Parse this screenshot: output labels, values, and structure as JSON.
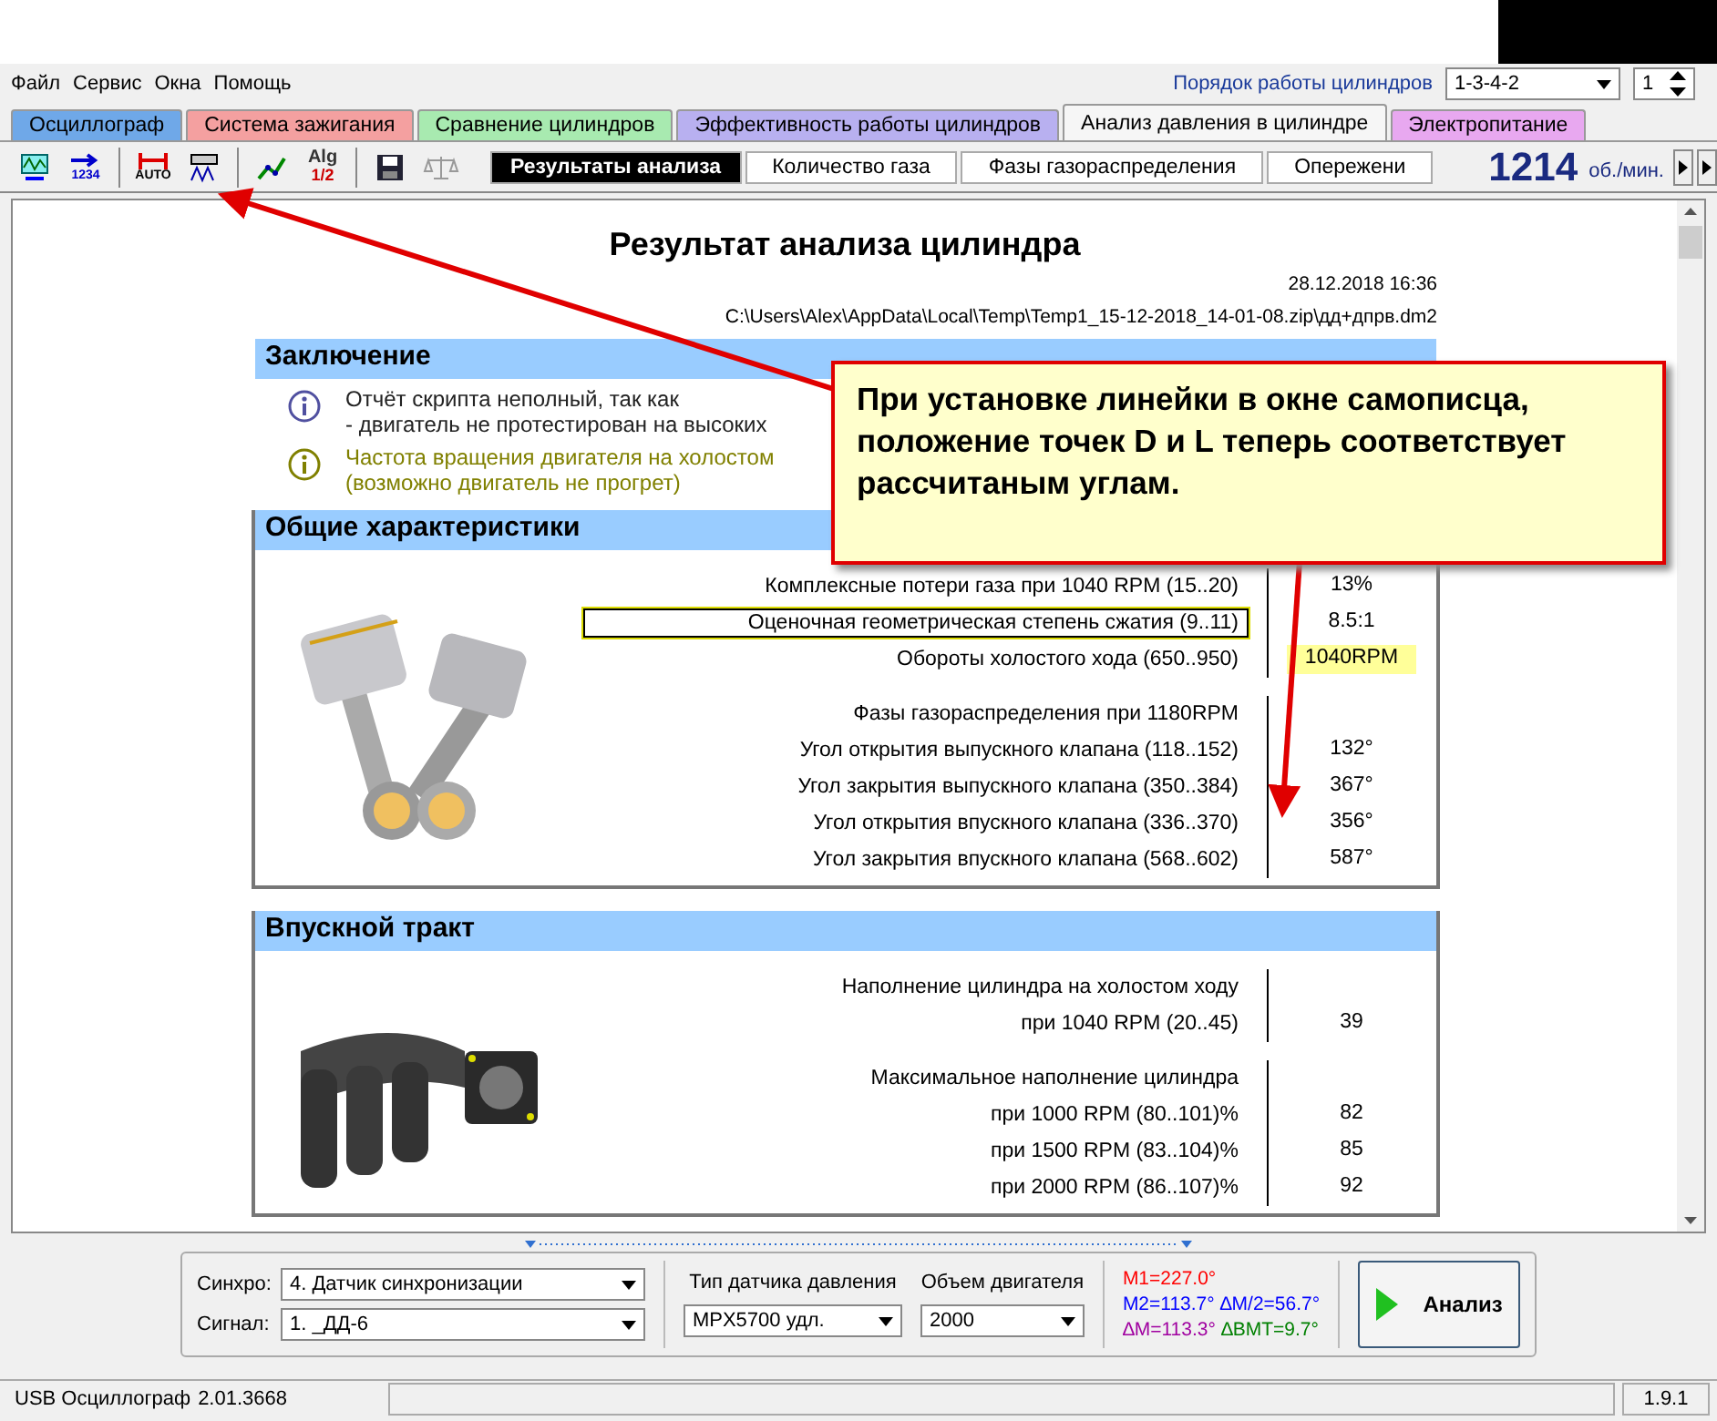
{
  "menu": [
    "Файл",
    "Сервис",
    "Окна",
    "Помощь"
  ],
  "cylinder_order": {
    "label": "Порядок работы цилиндров",
    "value": "1-3-4-2",
    "spin": "1"
  },
  "tabs": [
    {
      "label": "Осциллограф",
      "color": "#6fa8e8",
      "selected": false
    },
    {
      "label": "Система зажигания",
      "color": "#f4a0a0",
      "selected": false
    },
    {
      "label": "Сравнение цилиндров",
      "color": "#a8eab0",
      "selected": false
    },
    {
      "label": "Эффективность работы цилиндров",
      "color": "#b8b0f0",
      "selected": false
    },
    {
      "label": "Анализ давления в цилиндре",
      "color": "#f6f6f6",
      "selected": true
    },
    {
      "label": "Электропитание",
      "color": "#e8a8f0",
      "selected": false
    }
  ],
  "toolbar": [
    {
      "kind": "scope"
    },
    {
      "kind": "counter",
      "caption": "1234"
    },
    {
      "kind": "auto",
      "caption": "AUTO"
    },
    {
      "kind": "ruler"
    },
    {
      "kind": "graph"
    },
    {
      "kind": "alg",
      "caption": "Alg",
      "subcaption": "1/2"
    },
    {
      "kind": "save"
    },
    {
      "kind": "scales"
    }
  ],
  "subtabs": [
    {
      "label": "Результаты анализа",
      "selected": true
    },
    {
      "label": "Количество газа",
      "selected": false
    },
    {
      "label": "Фазы газораспределения",
      "selected": false
    },
    {
      "label": "Опережени",
      "selected": false
    }
  ],
  "rpm": {
    "value": "1214",
    "unit": "об./мин."
  },
  "report": {
    "title": "Результат анализа цилиндра",
    "date": "28.12.2018 16:36",
    "path": "C:\\Users\\Alex\\AppData\\Local\\Temp\\Temp1_15-12-2018_14-01-08.zip\\дд+дпрв.dm2",
    "conclusion": {
      "title": "Заключение",
      "items": [
        {
          "kind": "info",
          "lines": [
            "Отчёт скрипта неполный, так как",
            "- двигатель не протестирован на высоких"
          ]
        },
        {
          "kind": "warning",
          "lines": [
            "Частота вращения двигателя на холостом",
            "(возможно двигатель не прогрет)"
          ]
        }
      ]
    },
    "sections": [
      {
        "title": "Общие характеристики",
        "kind": "picture",
        "groups": [
          [
            {
              "label": "Комплексные потери газа при 1040 RPM (15..20)",
              "value": "13%",
              "focused": false,
              "highlighted": false
            },
            {
              "label": "Оценочная геометрическая степень сжатия (9..11)",
              "value": "8.5:1",
              "focused": true,
              "highlighted": false
            },
            {
              "label": "Обороты холостого хода (650..950)",
              "value": "1040RPM",
              "focused": false,
              "highlighted": true
            }
          ],
          [
            {
              "label": "Фазы газораспределения при 1180RPM",
              "focused": false
            },
            {
              "label": "Угол открытия выпускного клапана (118..152)",
              "value": "132°",
              "focused": false,
              "highlighted": false
            },
            {
              "label": "Угол закрытия выпускного клапана (350..384)",
              "value": "367°",
              "focused": false,
              "highlighted": false
            },
            {
              "label": "Угол открытия впускного клапана (336..370)",
              "value": "356°",
              "focused": false,
              "highlighted": false
            },
            {
              "label": "Угол закрытия впускного клапана (568..602)",
              "value": "587°",
              "focused": false,
              "highlighted": false
            }
          ]
        ]
      },
      {
        "title": "Впускной тракт",
        "kind": "picture",
        "groups": [
          [
            {
              "label": "Наполнение цилиндра на холостом ходу",
              "focused": false
            },
            {
              "label": "при 1040 RPM (20..45)",
              "value": "39",
              "focused": false,
              "highlighted": false
            }
          ],
          [
            {
              "label": "Максимальное наполнение цилиндра",
              "focused": false
            },
            {
              "label": "при  1000 RPM (80..101)%",
              "value": "82",
              "focused": false,
              "highlighted": false
            },
            {
              "label": "при  1500 RPM (83..104)%",
              "value": "85",
              "focused": false,
              "highlighted": false
            },
            {
              "label": "при  2000 RPM (86..107)%",
              "value": "92",
              "focused": false,
              "highlighted": false
            }
          ]
        ]
      }
    ]
  },
  "callout": {
    "text": "При установке линейки в окне самописца, положение точек D и L теперь соответствует рассчитаным углам."
  },
  "settings": {
    "sync": {
      "label": "Синхро:",
      "value": "4.  Датчик синхронизации"
    },
    "signal": {
      "label": "Сигнал:",
      "value": "1.  _ДД-6"
    },
    "sensor": {
      "label": "Тип датчика давления",
      "value": "MPX5700 удл."
    },
    "volume": {
      "label": "Объем двигателя",
      "value": "2000"
    },
    "measurements": [
      [
        {
          "text": "M1=227.0°",
          "color": "#ff0000"
        }
      ],
      [
        {
          "text": "M2=113.7°",
          "color": "#0000ff"
        },
        {
          "text": "∆M/2=56.7°",
          "color": "#0000ff"
        }
      ],
      [
        {
          "text": "∆M=113.3°",
          "color": "#a000a0"
        },
        {
          "text": "∆BMT=9.7°",
          "color": "#008000"
        }
      ]
    ],
    "analyze": "Анализ"
  },
  "status_bar": [
    "USB Осциллограф",
    "2.01.3668"
  ],
  "version": "1.9.1"
}
